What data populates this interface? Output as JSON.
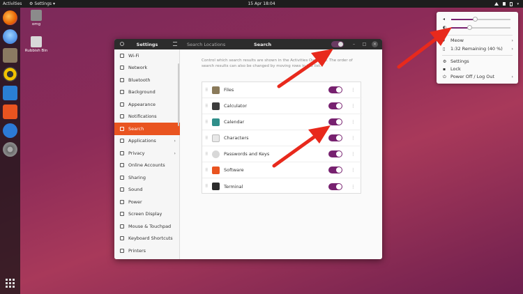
{
  "topbar": {
    "activities": "Activities",
    "app_menu": "Settings",
    "clock": "15 Apr  18:04"
  },
  "desktop": {
    "icons": [
      {
        "label": "omg"
      },
      {
        "label": "Rubbish Bin"
      }
    ]
  },
  "window": {
    "sidebar_title": "Settings",
    "header_sublabel": "Search Locations",
    "title": "Search",
    "minimize": "–",
    "maximize": "□",
    "close": "×"
  },
  "sidebar": {
    "items": [
      {
        "label": "Wi-Fi",
        "icon": "wifi-icon"
      },
      {
        "label": "Network",
        "icon": "network-icon"
      },
      {
        "label": "Bluetooth",
        "icon": "bluetooth-icon"
      },
      {
        "label": "Background",
        "icon": "background-icon"
      },
      {
        "label": "Appearance",
        "icon": "appearance-icon"
      },
      {
        "label": "Notifications",
        "icon": "bell-icon"
      },
      {
        "label": "Search",
        "icon": "search-icon",
        "active": true
      },
      {
        "label": "Applications",
        "icon": "apps-icon",
        "chevron": "›"
      },
      {
        "label": "Privacy",
        "icon": "privacy-icon",
        "chevron": "›"
      },
      {
        "label": "Online Accounts",
        "icon": "accounts-icon"
      },
      {
        "label": "Sharing",
        "icon": "sharing-icon"
      },
      {
        "label": "Sound",
        "icon": "sound-icon"
      },
      {
        "label": "Power",
        "icon": "power-icon"
      },
      {
        "label": "Screen Display",
        "icon": "display-icon"
      },
      {
        "label": "Mouse & Touchpad",
        "icon": "mouse-icon"
      },
      {
        "label": "Keyboard Shortcuts",
        "icon": "keyboard-icon"
      },
      {
        "label": "Printers",
        "icon": "printer-icon"
      }
    ]
  },
  "content": {
    "description": "Control which search results are shown in the Activities Overview. The order of search results can also be changed by moving rows in the list.",
    "rows": [
      {
        "label": "Files",
        "color": "#8a7a5a",
        "enabled": true
      },
      {
        "label": "Calculator",
        "color": "#3c3c3c",
        "enabled": true
      },
      {
        "label": "Calendar",
        "color": "#2f8f8a",
        "enabled": true
      },
      {
        "label": "Characters",
        "color": "#e8e8e8",
        "enabled": true
      },
      {
        "label": "Passwords and Keys",
        "color": "#d8d8d8",
        "enabled": true
      },
      {
        "label": "Software",
        "color": "#e95420",
        "enabled": true
      },
      {
        "label": "Terminal",
        "color": "#2c2c2c",
        "enabled": true
      }
    ],
    "drag_glyph": "⠿",
    "more_glyph": "⋮"
  },
  "system_menu": {
    "volume_level": 0.4,
    "brightness_level": 0.3,
    "wifi": "Meow",
    "battery": "1:32 Remaining (40 %)",
    "settings": "Settings",
    "lock": "Lock",
    "power": "Power Off / Log Out",
    "chevron": "›"
  },
  "colors": {
    "accent": "#e95420",
    "toggle_on": "#77216f",
    "arrow": "#e8291c"
  }
}
